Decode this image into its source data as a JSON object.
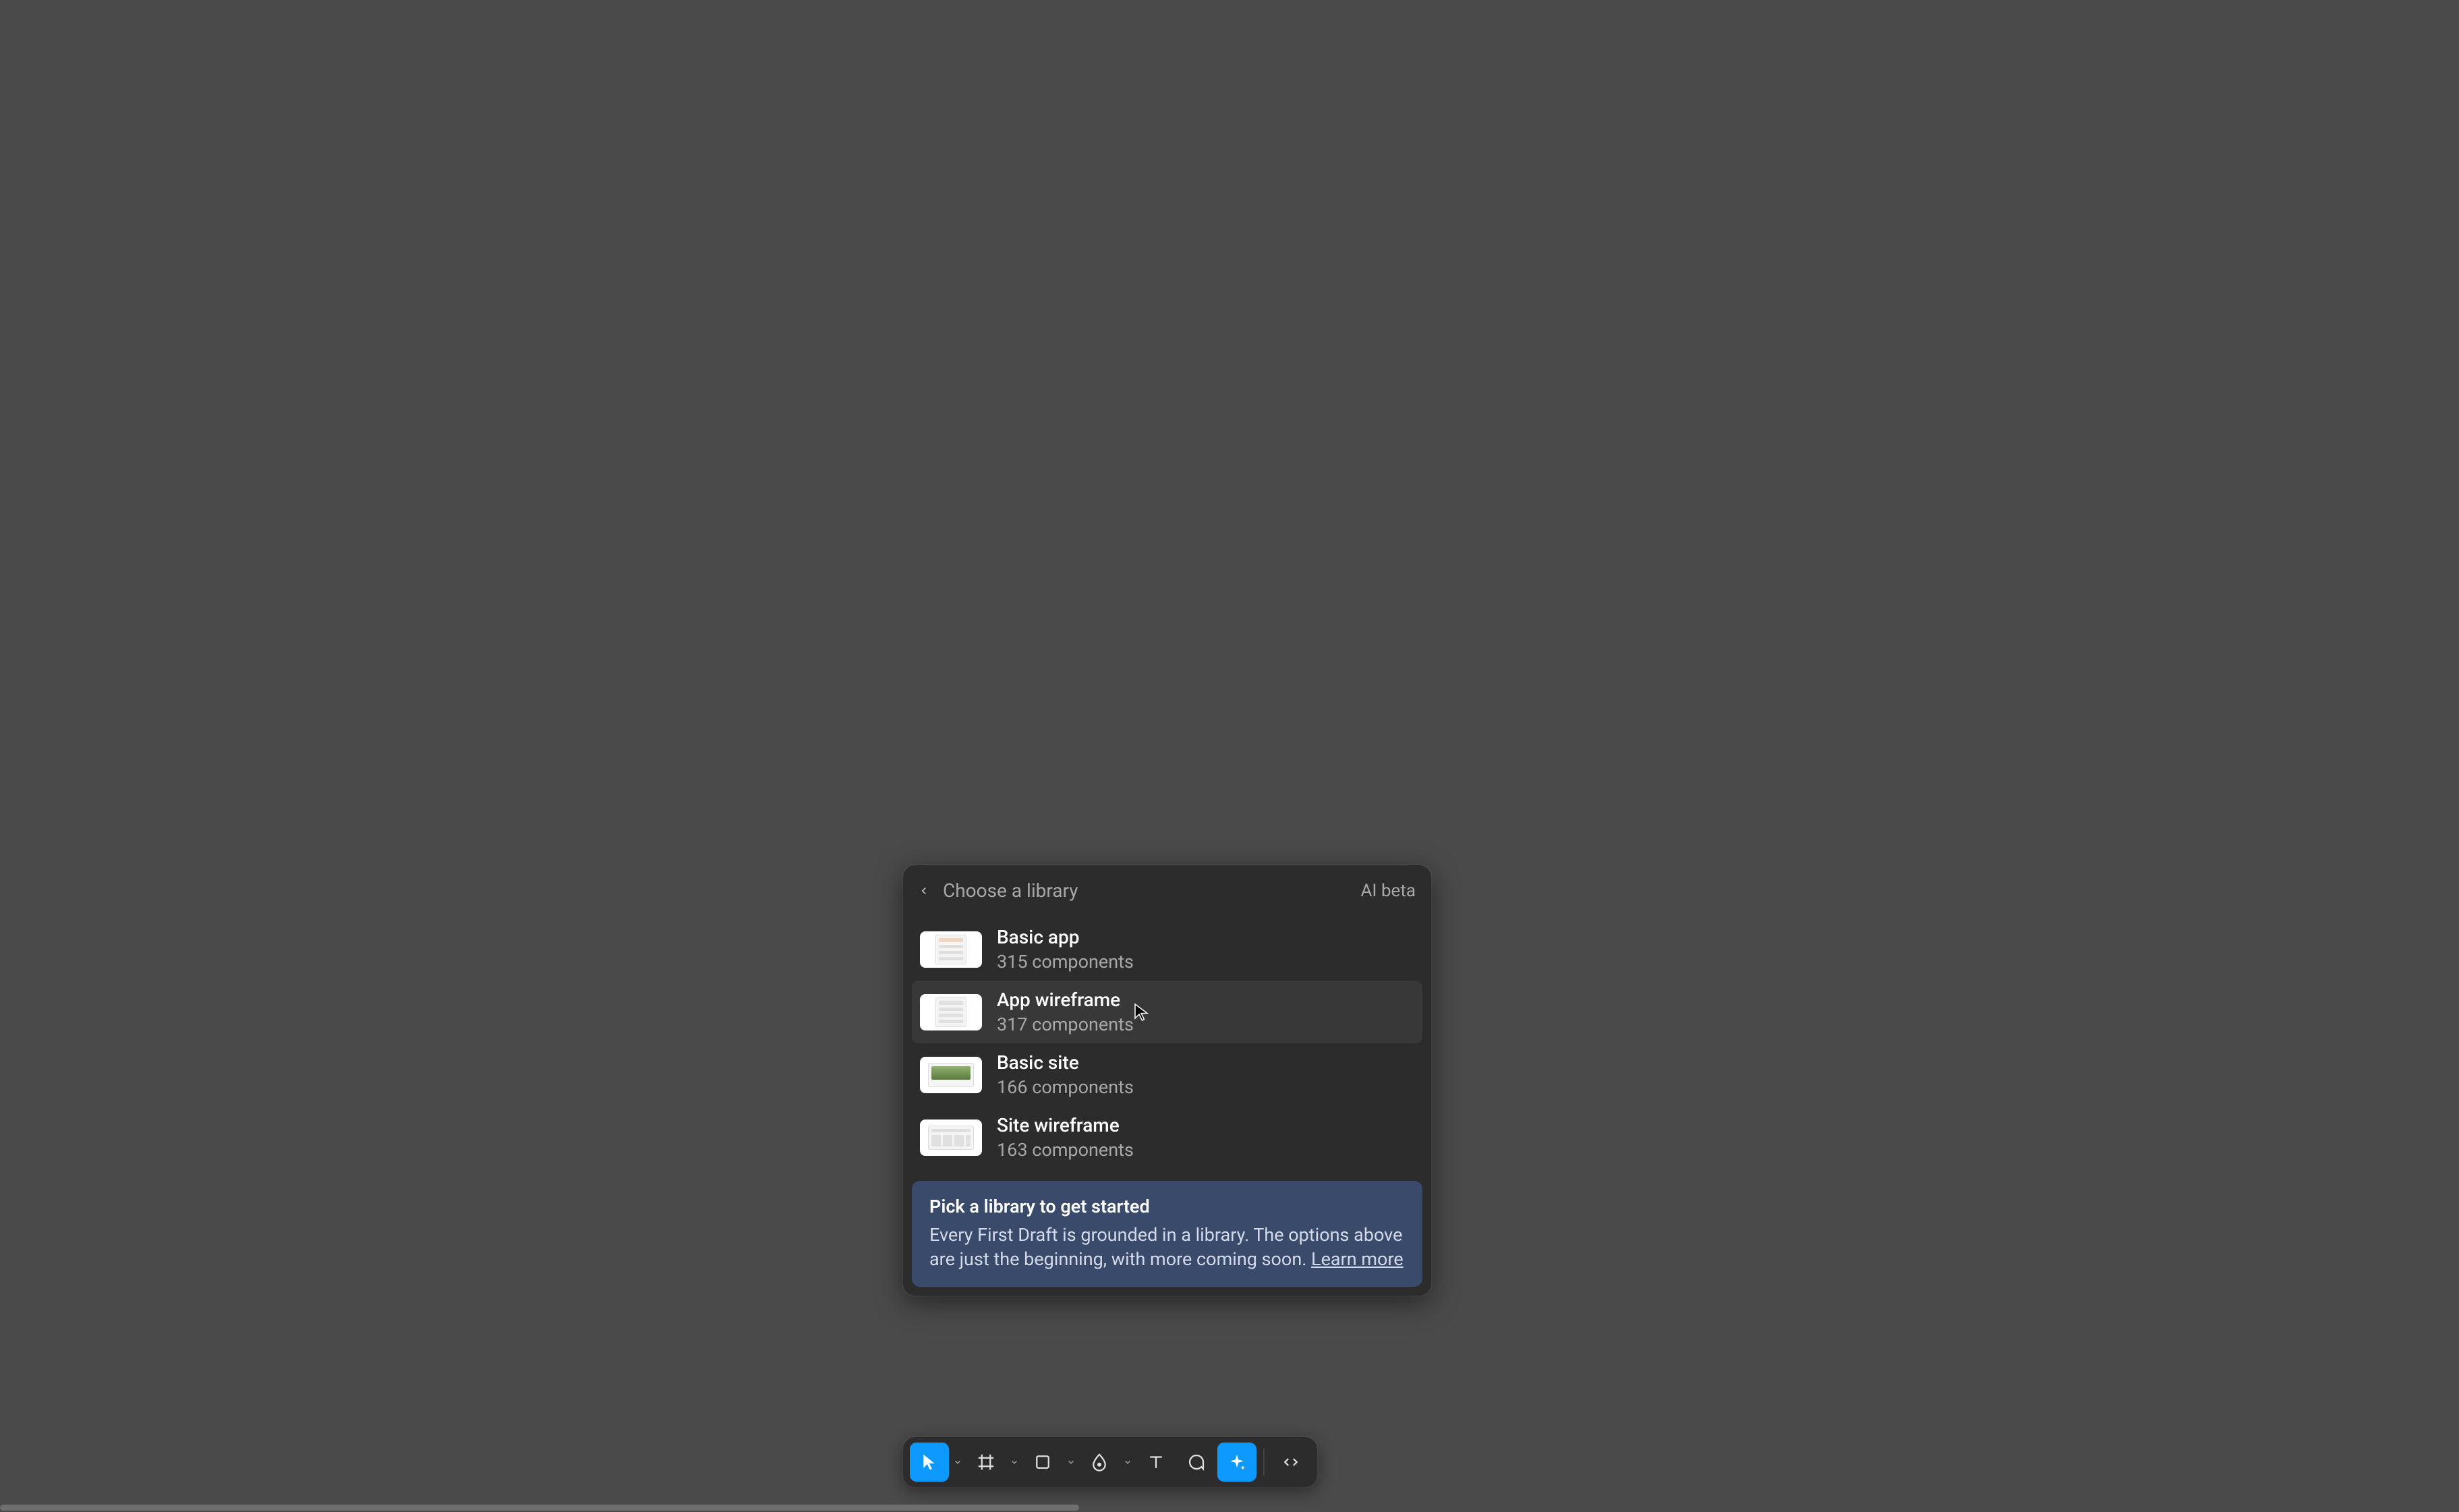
{
  "dialog": {
    "title": "Choose a library",
    "badge": "AI beta",
    "libraries": [
      {
        "name": "Basic app",
        "subtitle": "315 components",
        "thumb_kind": "basic-app"
      },
      {
        "name": "App wireframe",
        "subtitle": "317 components",
        "thumb_kind": "app-wf",
        "hovered": true
      },
      {
        "name": "Basic site",
        "subtitle": "166 components",
        "thumb_kind": "site"
      },
      {
        "name": "Site wireframe",
        "subtitle": "163 components",
        "thumb_kind": "site-wf"
      }
    ],
    "info": {
      "title": "Pick a library to get started",
      "body_prefix": "Every First Draft is grounded in a library. The options above are just the beginning, with more coming soon. ",
      "learn_more": "Learn more"
    }
  },
  "toolbar": {
    "items": [
      {
        "name": "move-tool",
        "icon": "cursor",
        "active": true,
        "caret": true
      },
      {
        "name": "frame-tool",
        "icon": "frame",
        "active": false,
        "caret": true
      },
      {
        "name": "shape-tool",
        "icon": "rect",
        "active": false,
        "caret": true
      },
      {
        "name": "pen-tool",
        "icon": "pen",
        "active": false,
        "caret": true
      },
      {
        "name": "text-tool",
        "icon": "text",
        "active": false,
        "caret": false
      },
      {
        "name": "comment-tool",
        "icon": "comment",
        "active": false,
        "caret": false
      },
      {
        "name": "actions-tool",
        "icon": "sparkle",
        "active": true,
        "caret": false
      },
      {
        "name": "dev-mode",
        "icon": "code",
        "active": false,
        "caret": false,
        "separated": true
      }
    ]
  }
}
